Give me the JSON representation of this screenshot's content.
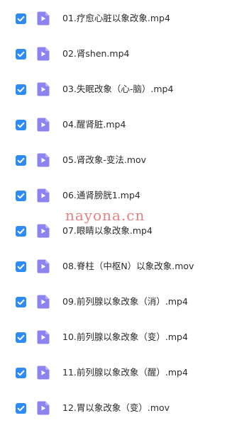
{
  "colors": {
    "checkbox": "#2f8cf6",
    "video_icon": "#8c82f0",
    "watermark": "#e25c5c"
  },
  "icons": {
    "checkbox": "checkbox-checked-icon",
    "file": "video-file-icon"
  },
  "files": [
    {
      "name": "01.疗愈心脏以象改象.mp4",
      "checked": true
    },
    {
      "name": "02.肾shen.mp4",
      "checked": true
    },
    {
      "name": "03.失眠改象（心-脑）.mp4",
      "checked": true
    },
    {
      "name": "04.醒肾脏.mp4",
      "checked": true
    },
    {
      "name": "05.肾改象-变法.mov",
      "checked": true
    },
    {
      "name": "06.通肾膀胱1.mp4",
      "checked": true
    },
    {
      "name": "07.眼睛以象改象.mp4",
      "checked": true
    },
    {
      "name": "08.脊柱（中枢N）以象改象.mov",
      "checked": true
    },
    {
      "name": "09.前列腺以象改象（消）.mp4",
      "checked": true
    },
    {
      "name": "10.前列腺以象改象（变）.mp4",
      "checked": true
    },
    {
      "name": "11.前列腺以象改象（醒）.mp4",
      "checked": true
    },
    {
      "name": "12.胃以象改象（变）.mov",
      "checked": true
    }
  ],
  "watermark": "nayona.cn"
}
